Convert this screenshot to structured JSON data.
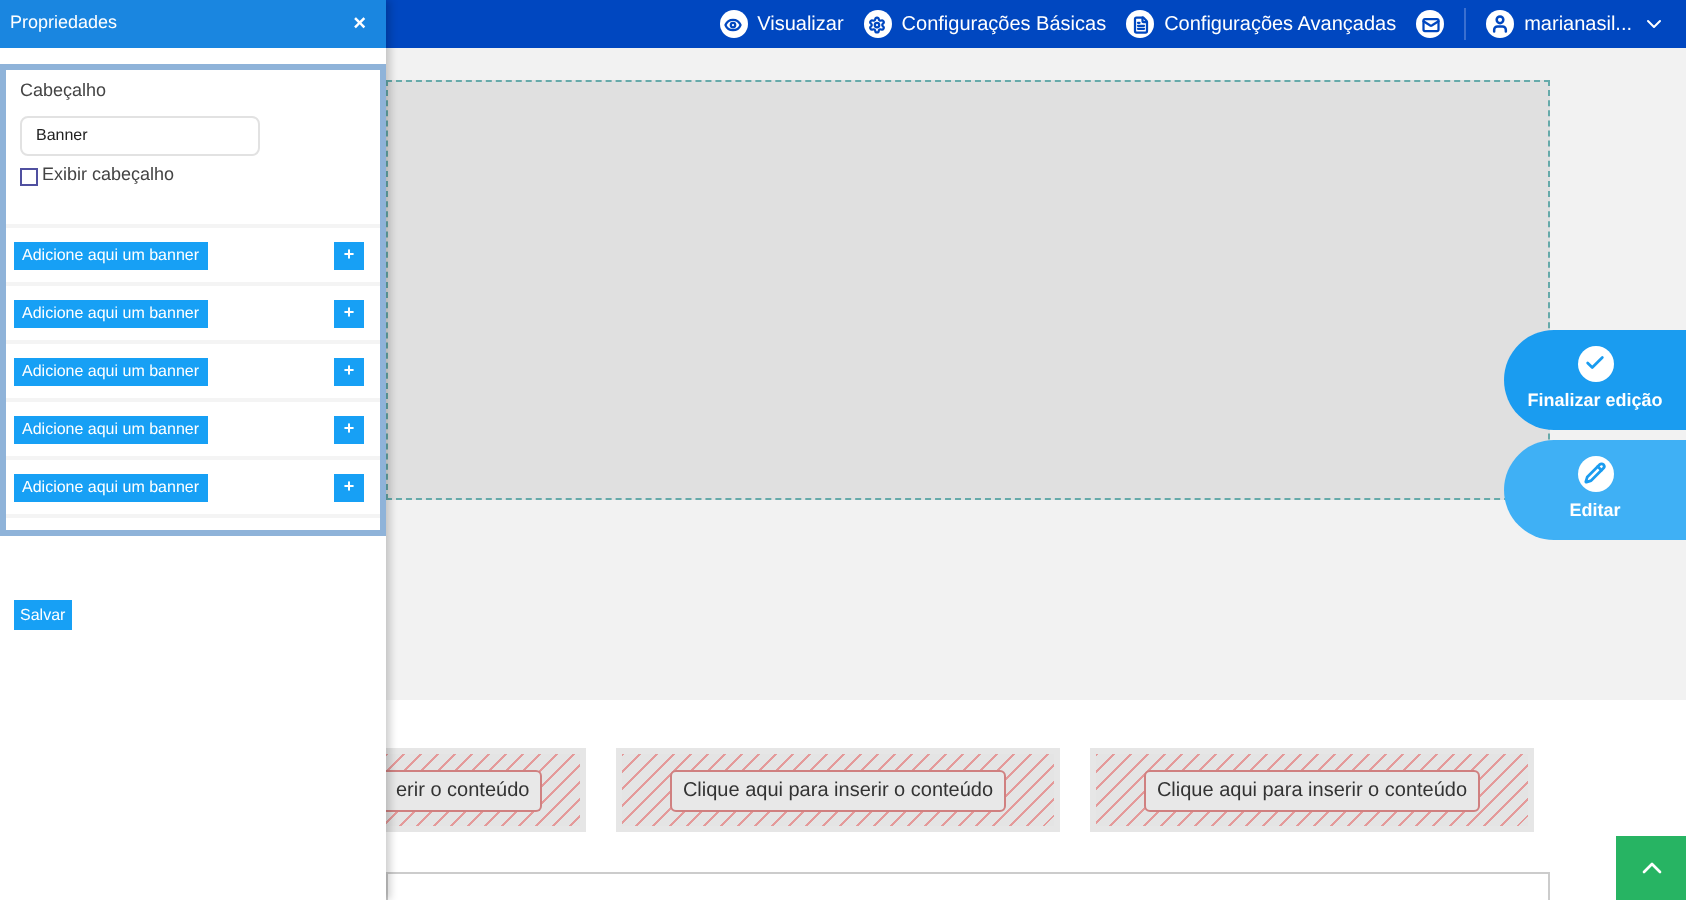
{
  "topbar": {
    "items": [
      {
        "kind": "preview",
        "label": "Visualizar"
      },
      {
        "kind": "gear",
        "label": "Configurações Básicas"
      },
      {
        "kind": "doc",
        "label": "Configurações Avançadas"
      },
      {
        "kind": "mail"
      }
    ],
    "user": {
      "name": "marianasil..."
    }
  },
  "panel": {
    "title": "Propriedades",
    "close": "×",
    "header_label": "Cabeçalho",
    "header_value": "Banner",
    "show_header": {
      "label": "Exibir cabeçalho",
      "checked": false
    },
    "banners": [
      {
        "label": "Adicione aqui um banner",
        "add": "+"
      },
      {
        "label": "Adicione aqui um banner",
        "add": "+"
      },
      {
        "label": "Adicione aqui um banner",
        "add": "+"
      },
      {
        "label": "Adicione aqui um banner",
        "add": "+"
      },
      {
        "label": "Adicione aqui um banner",
        "add": "+"
      }
    ],
    "save": "Salvar"
  },
  "actions": [
    {
      "kind": "check",
      "label": "Finalizar edição"
    },
    {
      "kind": "edit",
      "label": "Editar"
    }
  ],
  "content_slots": [
    {
      "label": "erir o conteúdo"
    },
    {
      "label": "Clique aqui para inserir o conteúdo"
    },
    {
      "label": "Clique aqui para inserir o conteúdo"
    }
  ]
}
